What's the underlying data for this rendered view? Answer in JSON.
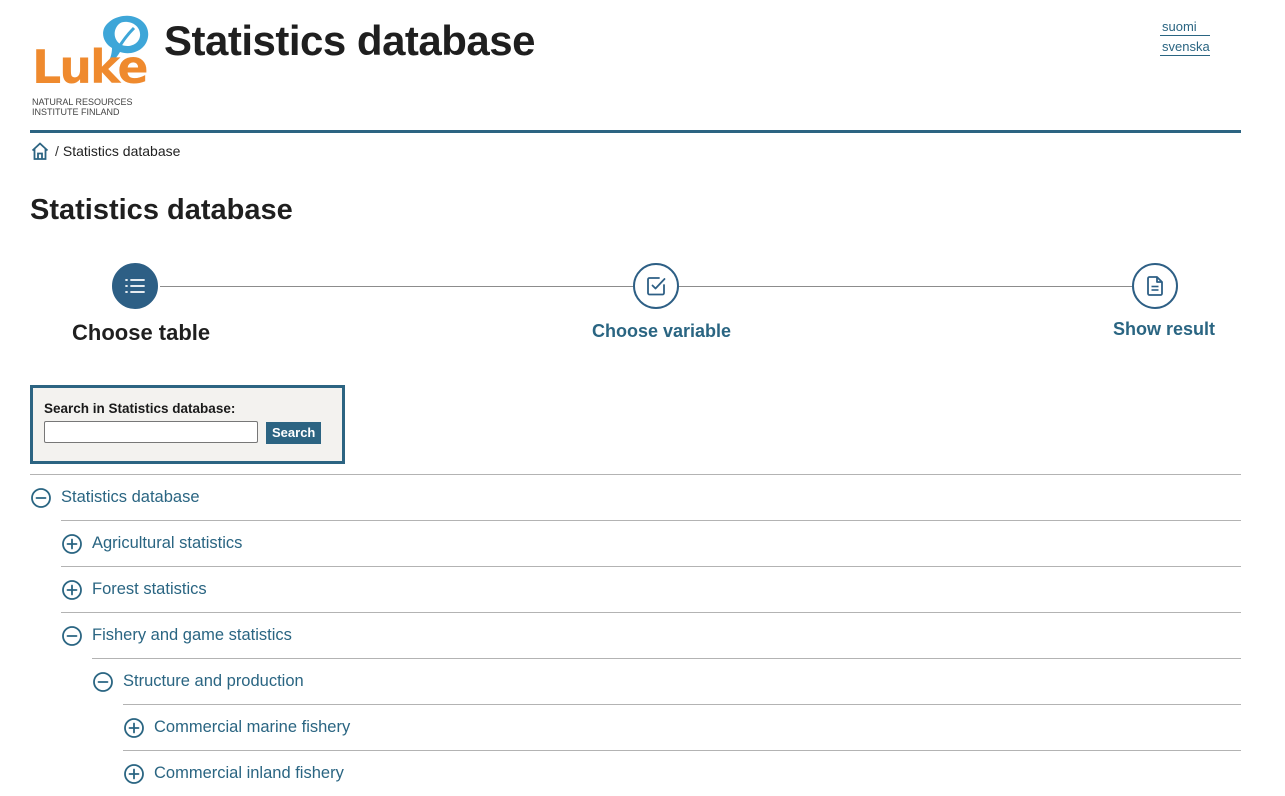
{
  "header": {
    "logo": {
      "wordmark": "Luke",
      "subtitle_line1": "NATURAL RESOURCES",
      "subtitle_line2": "INSTITUTE FINLAND",
      "colors": {
        "orange": "#ef8a2e",
        "leaf": "#3ea6d8"
      }
    },
    "site_title": "Statistics database",
    "languages": [
      "suomi",
      "svenska"
    ]
  },
  "breadcrumb": {
    "home_icon": "home-icon",
    "separator": "/",
    "current": "Statistics database"
  },
  "page_title": "Statistics database",
  "stepper": {
    "steps": [
      {
        "label": "Choose table",
        "icon": "list-icon",
        "state": "active"
      },
      {
        "label": "Choose variable",
        "icon": "checkbox-icon",
        "state": "inactive"
      },
      {
        "label": "Show result",
        "icon": "document-icon",
        "state": "inactive"
      }
    ]
  },
  "search": {
    "label": "Search in Statistics database:",
    "value": "",
    "button_label": "Search"
  },
  "tree": {
    "items": [
      {
        "label": "Statistics database",
        "level": 0,
        "expanded": true
      },
      {
        "label": "Agricultural statistics",
        "level": 1,
        "expanded": false
      },
      {
        "label": "Forest statistics",
        "level": 1,
        "expanded": false
      },
      {
        "label": "Fishery and game statistics",
        "level": 1,
        "expanded": true
      },
      {
        "label": "Structure and production",
        "level": 2,
        "expanded": true
      },
      {
        "label": "Commercial marine fishery",
        "level": 3,
        "expanded": false
      },
      {
        "label": "Commercial inland fishery",
        "level": 3,
        "expanded": false
      }
    ]
  },
  "colors": {
    "primary": "#2c6482",
    "link": "#2a6582",
    "search_bg": "#f3f2ef",
    "divider": "#b3b3b3"
  }
}
